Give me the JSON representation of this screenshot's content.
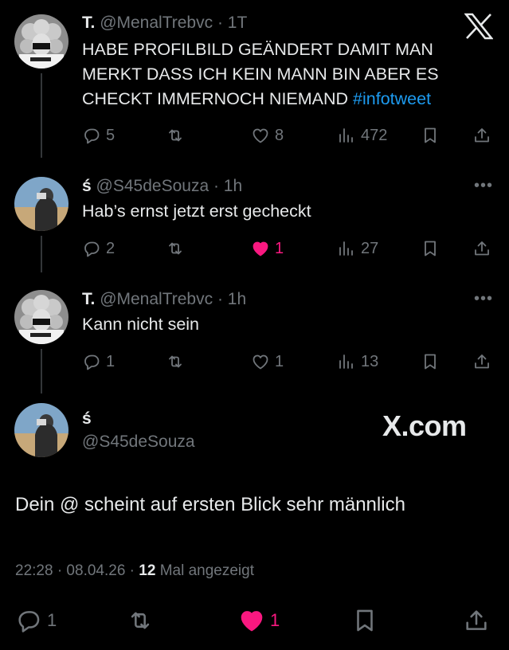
{
  "tweets": [
    {
      "name": "T.",
      "handle": "@MenalTrebvc",
      "time": "· 1T",
      "text": "HABE PROFILBILD GEÄNDERT DAMIT MAN MERKT DASS ICH KEIN MANN BIN ABER ES CHECKT IMMERNOCH NIEMAND ",
      "hashtag": "#infotweet",
      "replies": "5",
      "retweets": "",
      "likes": "8",
      "views": "472",
      "liked": false
    },
    {
      "name": "ś",
      "handle": "@S45deSouza",
      "time": "· 1h",
      "text": "Hab’s ernst jetzt erst gecheckt",
      "replies": "2",
      "retweets": "",
      "likes": "1",
      "views": "27",
      "liked": true
    },
    {
      "name": "T.",
      "handle": "@MenalTrebvc",
      "time": "· 1h",
      "text": "Kann nicht sein",
      "replies": "1",
      "retweets": "",
      "likes": "1",
      "views": "13",
      "liked": false
    }
  ],
  "main_tweet": {
    "name": "ś",
    "handle": "@S45deSouza",
    "text": "Dein @ scheint auf ersten Blick sehr männlich",
    "timestamp": "22:28 · 08.04.26 · ",
    "views_count": "12",
    "views_label": " Mal angezeigt",
    "replies": "1",
    "likes": "1",
    "liked": true
  },
  "watermark": "X.com",
  "more_label": "•••",
  "colors": {
    "background": "#000000",
    "text": "#e7e9ea",
    "muted": "#71767b",
    "link": "#1d9bf0",
    "like": "#f91880"
  },
  "icons": [
    "x-logo-icon",
    "reply-icon",
    "retweet-icon",
    "heart-icon",
    "views-icon",
    "bookmark-icon",
    "share-icon",
    "more-icon"
  ]
}
